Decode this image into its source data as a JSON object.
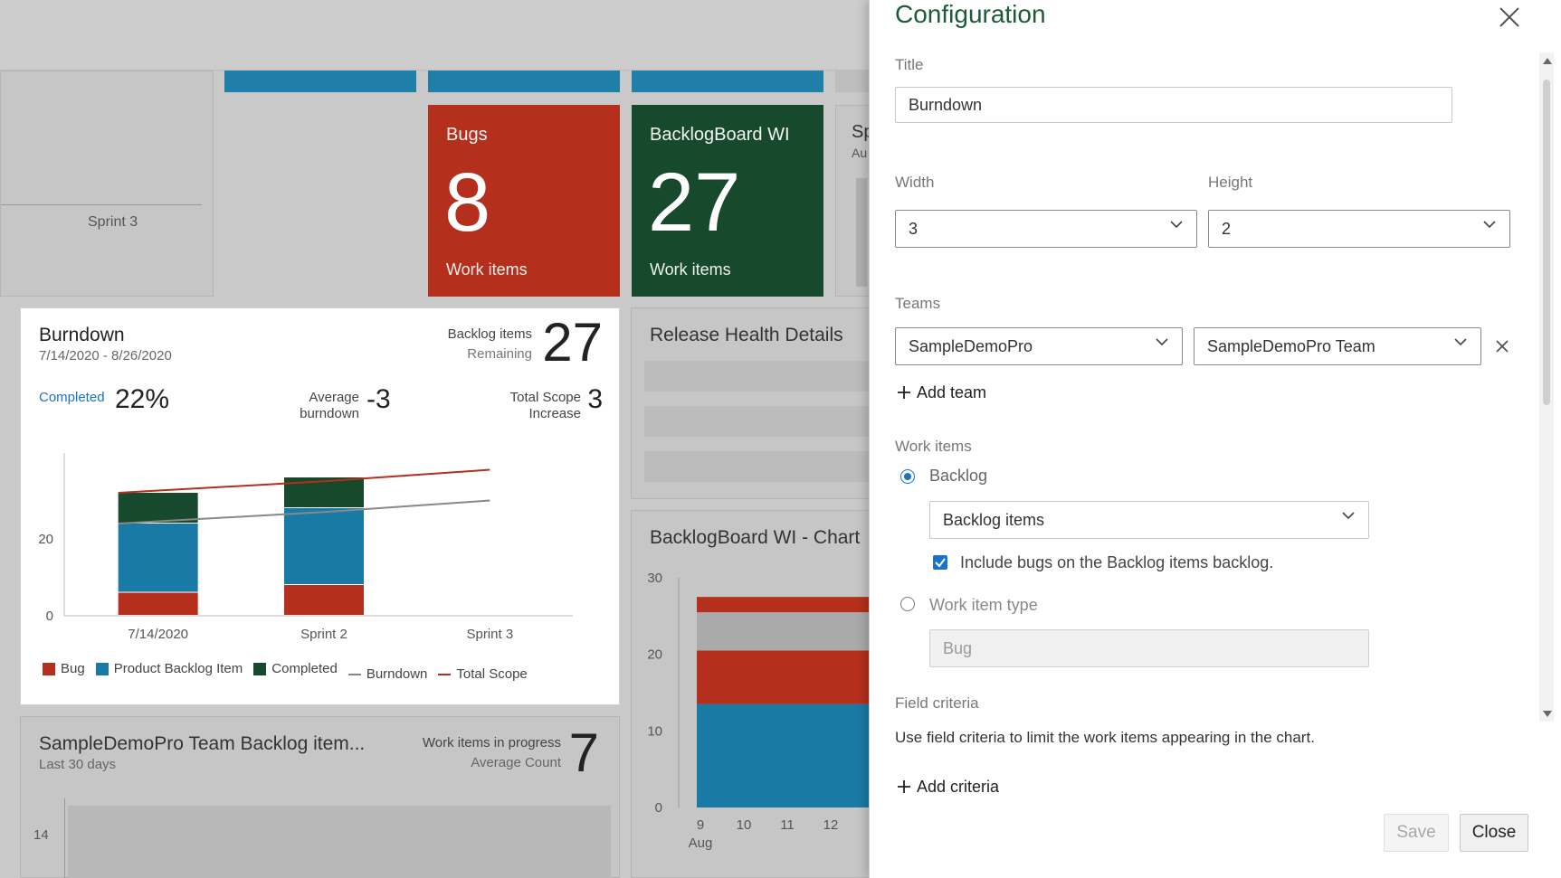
{
  "dashboard": {
    "sprint3_label": "Sprint 3",
    "bugs_tile": {
      "title": "Bugs",
      "value": "8",
      "sub": "Work items",
      "color": "#b5301c"
    },
    "backlog_tile": {
      "title": "BacklogBoard WI",
      "value": "27",
      "sub": "Work items",
      "color": "#174a2d"
    },
    "partial_tile": {
      "line1": "Sp",
      "line2": "Au"
    },
    "burndown": {
      "title": "Burndown",
      "date_range": "7/14/2020 - 8/26/2020",
      "remaining_label_1": "Backlog items",
      "remaining_label_2": "Remaining",
      "remaining_value": "27",
      "completed_label": "Completed",
      "completed_value": "22%",
      "avg_label_1": "Average",
      "avg_label_2": "burndown",
      "avg_value": "-3",
      "scope_label_1": "Total Scope",
      "scope_label_2": "Increase",
      "scope_value": "3"
    },
    "release_health": {
      "title": "Release Health Details"
    },
    "backlog_chart": {
      "title": "BacklogBoard WI - Chart"
    },
    "team_backlog": {
      "title": "SampleDemoPro Team Backlog item...",
      "sub": "Last 30 days",
      "wip_label_1": "Work items in progress",
      "wip_label_2": "Average Count",
      "wip_value": "7",
      "y_tick": "14"
    }
  },
  "chart_data": [
    {
      "type": "bar",
      "categories": [
        "7/14/2020",
        "Sprint 2",
        "Sprint 3"
      ],
      "series": [
        {
          "name": "Bug",
          "values": [
            6,
            8,
            0
          ],
          "color": "#b5301c"
        },
        {
          "name": "Product Backlog Item",
          "values": [
            18,
            20,
            0
          ],
          "color": "#1a7aa6"
        },
        {
          "name": "Completed",
          "values": [
            8,
            8,
            0
          ],
          "color": "#174a2d"
        },
        {
          "name": "Burndown",
          "values": [
            24,
            27,
            30
          ],
          "color": "#888888"
        },
        {
          "name": "Total Scope",
          "values": [
            32,
            35,
            38
          ],
          "color": "#b5301c"
        }
      ],
      "y_ticks": [
        "0",
        "20"
      ],
      "ylim": [
        0,
        40
      ]
    },
    {
      "type": "bar",
      "categories": [
        "9",
        "10",
        "11",
        "12"
      ],
      "x_sub": "Aug",
      "series": [
        {
          "name": "",
          "values": [
            13.5
          ],
          "color": "#1a7aa6"
        },
        {
          "name": "",
          "values": [
            7
          ],
          "color": "#b5301c"
        },
        {
          "name": "",
          "values": [
            5
          ],
          "color": "#aaaaaa"
        },
        {
          "name": "",
          "values": [
            2
          ],
          "color": "#b5301c"
        }
      ],
      "y_ticks": [
        "0",
        "10",
        "20",
        "30"
      ],
      "ylim": [
        0,
        30
      ]
    }
  ],
  "config": {
    "title": "Configuration",
    "title_label": "Title",
    "title_value": "Burndown",
    "width_label": "Width",
    "width_value": "3",
    "height_label": "Height",
    "height_value": "2",
    "teams_label": "Teams",
    "project_value": "SampleDemoPro",
    "team_value": "SampleDemoPro Team",
    "add_team": "Add team",
    "work_items_label": "Work items",
    "backlog_option": "Backlog",
    "backlog_value": "Backlog items",
    "include_bugs": "Include bugs on the Backlog items backlog.",
    "work_item_type_option": "Work item type",
    "work_item_type_value": "Bug",
    "field_criteria_label": "Field criteria",
    "field_criteria_desc": "Use field criteria to limit the work items appearing in the chart.",
    "add_criteria": "Add criteria",
    "save": "Save",
    "close": "Close"
  }
}
